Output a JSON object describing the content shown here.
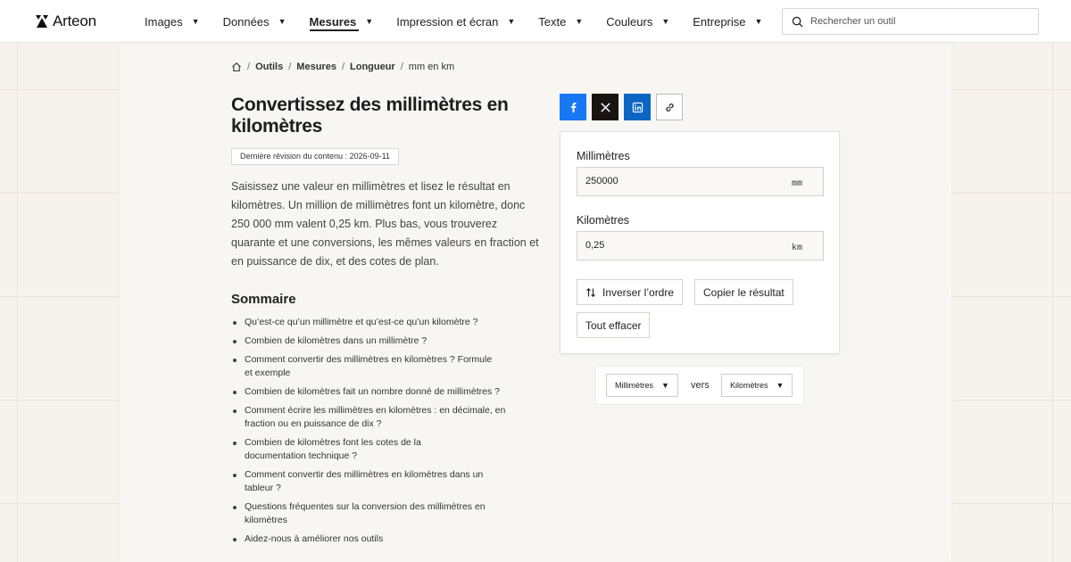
{
  "header": {
    "brand": "Arteon",
    "nav": [
      {
        "label": "Images",
        "active": false
      },
      {
        "label": "Données",
        "active": false
      },
      {
        "label": "Mesures",
        "active": true
      },
      {
        "label": "Impression et écran",
        "active": false
      },
      {
        "label": "Texte",
        "active": false
      },
      {
        "label": "Couleurs",
        "active": false
      },
      {
        "label": "Entreprise",
        "active": false
      }
    ],
    "search_placeholder": "Rechercher un outil"
  },
  "breadcrumb": {
    "items": [
      "Outils",
      "Mesures",
      "Longueur"
    ],
    "current": "mm en km"
  },
  "article": {
    "title": "Convertissez des millimètres en kilomètres",
    "revision": "Dernière révision du contenu : 2026-09-11",
    "intro": "Saisissez une valeur en millimètres et lisez le résultat en kilomètres. Un million de millimètres font un kilomètre, donc 250 000 mm valent 0,25 km. Plus bas, vous trouverez quarante et une conversions, les mêmes valeurs en fraction et en puissance de dix, et des cotes de plan.",
    "summary_title": "Sommaire",
    "toc": [
      "Qu’est-ce qu’un millimètre et qu’est-ce qu’un kilomètre ?",
      "Combien de kilomètres dans un millimètre ?",
      "Comment convertir des millimètres en kilomètres ? Formule et exemple",
      "Combien de kilomètres fait un nombre donné de millimètres ?",
      "Comment écrire les millimètres en kilomètres : en décimale, en fraction ou en puissance de dix ?",
      "Combien de kilomètres font les cotes de la documentation technique ?",
      "Comment convertir des millimètres en kilomètres dans un tableur ?",
      "Questions fréquentes sur la conversion des millimètres en kilomètres",
      "Aidez-nous à améliorer nos outils"
    ]
  },
  "share": {
    "icons": [
      "facebook-icon",
      "x-icon",
      "linkedin-icon",
      "link-icon"
    ],
    "colors": {
      "facebook": "#1877f2",
      "x": "#1a1410",
      "linkedin": "#0a66c2"
    }
  },
  "converter": {
    "from_label": "Millimètres",
    "from_value": "250000",
    "from_unit": "mm",
    "to_label": "Kilomètres",
    "to_value": "0,25",
    "to_unit": "km",
    "swap_label": "Inverser l’ordre",
    "copy_label": "Copier le résultat",
    "clear_label": "Tout effacer"
  },
  "unit_selector": {
    "from": "Millimètres",
    "connector": "vers",
    "to": "Kilomètres"
  }
}
